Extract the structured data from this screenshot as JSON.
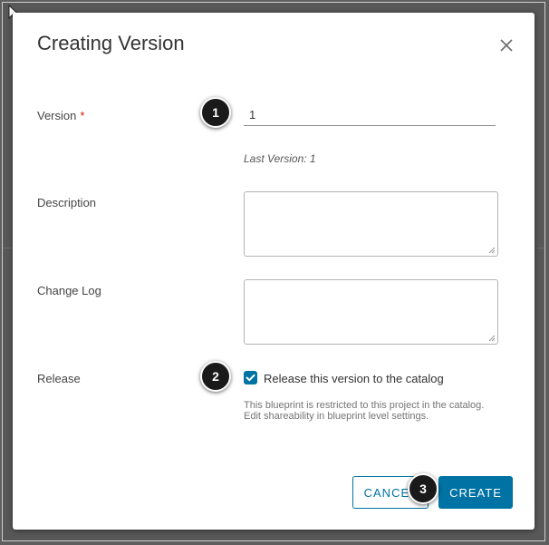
{
  "dialog": {
    "title": "Creating Version",
    "close_icon": "close-icon"
  },
  "fields": {
    "version": {
      "label": "Version",
      "required_mark": "*",
      "value": "1",
      "helper": "Last Version: 1"
    },
    "description": {
      "label": "Description",
      "value": ""
    },
    "change_log": {
      "label": "Change Log",
      "value": ""
    },
    "release": {
      "label": "Release",
      "checked": true,
      "checkbox_label": "Release this version to the catalog",
      "note_line1": "This blueprint is restricted to this project in the catalog.",
      "note_line2": "Edit shareability in blueprint level settings."
    }
  },
  "buttons": {
    "cancel": "CANCEL",
    "create": "CREATE"
  },
  "step_badges": [
    "1",
    "2",
    "3"
  ],
  "colors": {
    "accent": "#0072a3",
    "required": "#c92100",
    "badge": "#1a1a1a"
  }
}
